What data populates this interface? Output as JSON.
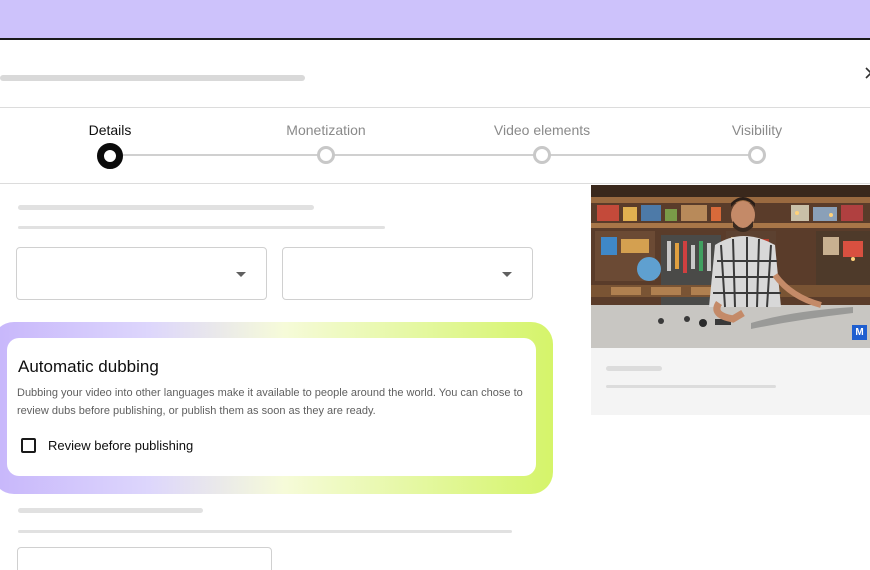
{
  "steps": [
    {
      "label": "Details",
      "active": true
    },
    {
      "label": "Monetization",
      "active": false
    },
    {
      "label": "Video elements",
      "active": false
    },
    {
      "label": "Visibility",
      "active": false
    }
  ],
  "dubbing": {
    "title": "Automatic dubbing",
    "description": "Dubbing your video into other languages make it available to people around the world. You can chose to review dubs before publishing, or publish them as soon as they are ready.",
    "checkbox_label": "Review before publishing",
    "checked": false
  },
  "video": {
    "badge": "M"
  },
  "colors": {
    "top_band": "#cdc2fb",
    "glow_start": "#c7b6fb",
    "glow_end": "#d5f46a",
    "active_step": "#0b0b0b"
  },
  "icons": [
    "close-icon",
    "dropdown-caret-icon",
    "checkbox-icon"
  ]
}
